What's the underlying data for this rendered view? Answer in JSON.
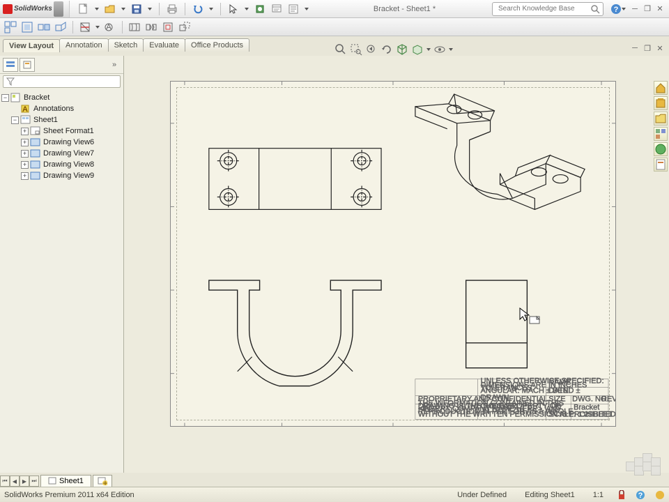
{
  "app": {
    "name": "SolidWorks",
    "doc_title": "Bracket - Sheet1 *"
  },
  "search": {
    "placeholder": "Search Knowledge Base"
  },
  "tabs": {
    "items": [
      "View Layout",
      "Annotation",
      "Sketch",
      "Evaluate",
      "Office Products"
    ],
    "active": 0
  },
  "tree": {
    "root": "Bracket",
    "items": [
      {
        "label": "Annotations",
        "icon": "annot"
      },
      {
        "label": "Sheet1",
        "icon": "sheet",
        "expanded": true,
        "children": [
          {
            "label": "Sheet Format1",
            "icon": "fmt"
          },
          {
            "label": "Drawing View6",
            "icon": "view"
          },
          {
            "label": "Drawing View7",
            "icon": "view"
          },
          {
            "label": "Drawing View8",
            "icon": "view"
          },
          {
            "label": "Drawing View9",
            "icon": "view"
          }
        ]
      }
    ]
  },
  "sheet_tab": "Sheet1",
  "status": {
    "edition": "SolidWorks Premium 2011 x64 Edition",
    "define": "Under Defined",
    "mode": "Editing Sheet1",
    "scale": "1:1"
  },
  "titleblock": {
    "size": "C",
    "name": "Bracket"
  }
}
